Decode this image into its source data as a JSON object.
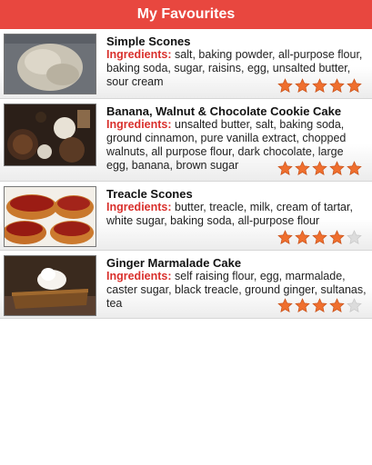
{
  "header": {
    "title": "My Favourites"
  },
  "ingredients_label": "Ingredients:",
  "recipes": [
    {
      "title": "Simple Scones",
      "ingredients": "salt, baking powder, all-purpose flour, baking soda, sugar, raisins, egg, unsalted butter, sour cream",
      "rating": 5
    },
    {
      "title": "Banana, Walnut & Chocolate Cookie Cake",
      "ingredients": "unsalted butter, salt, baking soda, ground cinnamon, pure vanilla extract, chopped walnuts, all purpose flour, dark chocolate, large egg, banana, brown sugar",
      "rating": 5
    },
    {
      "title": "Treacle Scones",
      "ingredients": "butter, treacle, milk, cream of tartar, white sugar, baking soda, all-purpose flour",
      "rating": 4
    },
    {
      "title": "Ginger Marmalade Cake",
      "ingredients": "self raising flour, egg, marmalade, caster sugar, black treacle, ground ginger, sultanas, tea",
      "rating": 4
    }
  ],
  "colors": {
    "header": "#e8473f",
    "ingredients_label": "#d9302c",
    "star_filled": "#ef6f2e",
    "star_empty": "#dcdcdc"
  },
  "icons": {
    "rating": "star-icon"
  }
}
